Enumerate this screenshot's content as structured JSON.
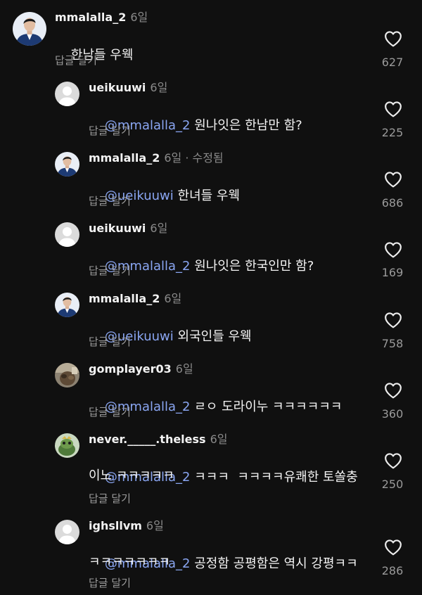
{
  "reply_label": "답글 달기",
  "comments": [
    {
      "username": "mmalalla_2",
      "time": "6일",
      "edited": "",
      "mention": "",
      "text": "한남들 우웩",
      "text2": "",
      "likes": "627"
    },
    {
      "username": "ueikuuwi",
      "time": "6일",
      "edited": "",
      "mention": "@mmalalla_2",
      "text": " 원나잇은 한남만 함?",
      "text2": "",
      "likes": "225"
    },
    {
      "username": "mmalalla_2",
      "time": "6일",
      "edited": " · 수정됨",
      "mention": "@ueikuuwi",
      "text": " 한녀들 우웩",
      "text2": "",
      "likes": "686"
    },
    {
      "username": "ueikuuwi",
      "time": "6일",
      "edited": "",
      "mention": "@mmalalla_2",
      "text": " 원나잇은 한국인만 함?",
      "text2": "",
      "likes": "169"
    },
    {
      "username": "mmalalla_2",
      "time": "6일",
      "edited": "",
      "mention": "@ueikuuwi",
      "text": " 외국인들 우웩",
      "text2": "",
      "likes": "758"
    },
    {
      "username": "gomplayer03",
      "time": "6일",
      "edited": "",
      "mention": "@mmalalla_2",
      "text": " ㄹㅇ 도라이누 ㅋㅋㅋㅋㅋㅋ",
      "text2": "",
      "likes": "360"
    },
    {
      "username": "never._____.theless",
      "time": "6일",
      "edited": "",
      "mention": "@mmalalla_2",
      "text": " ㅋㅋㅋ  ㅋㅋㅋㅋ유쾌한 토쏠충",
      "text2": "이노 ㅋㅋㅋㅋㅋ",
      "likes": "250"
    },
    {
      "username": "ighsllvm",
      "time": "6일",
      "edited": "",
      "mention": "@mmalalla_2",
      "text": " 공정함 공평함은 역시 강평ㅋㅋ",
      "text2": "ㅋㅋㅋㅋㅋㅋㅋ",
      "likes": "286"
    }
  ]
}
